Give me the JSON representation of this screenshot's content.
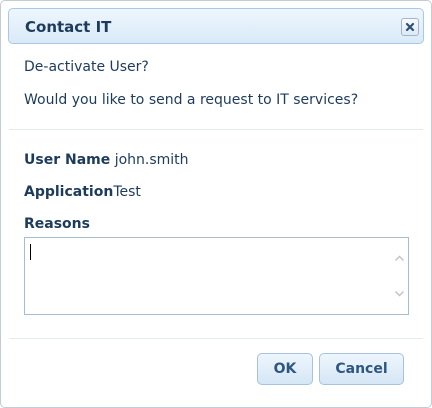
{
  "dialog": {
    "title": "Contact IT",
    "heading": "De-activate User?",
    "question": "Would you like to send a request to IT services?",
    "fields": {
      "user_name_label": "User Name",
      "user_name_value": "john.smith",
      "application_label": "Application",
      "application_value": "Test",
      "reasons_label": "Reasons",
      "reasons_value": ""
    },
    "buttons": {
      "ok_label": "OK",
      "cancel_label": "Cancel"
    },
    "icons": {
      "close": "close-icon",
      "scroll_up": "chevron-up-icon",
      "scroll_down": "chevron-down-icon"
    },
    "colors": {
      "title_text": "#1d3b5a",
      "button_text": "#2d5780",
      "titlebar_border": "#a8c8e6"
    }
  }
}
